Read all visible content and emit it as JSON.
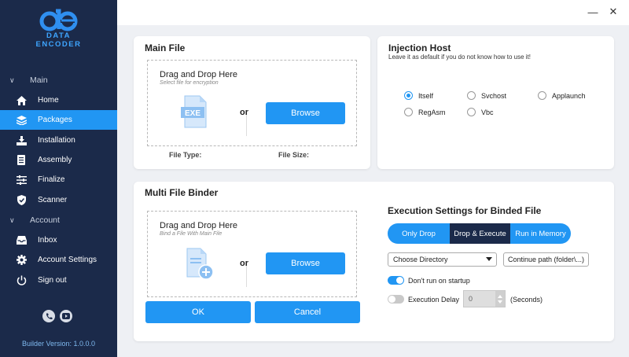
{
  "brand": {
    "line1": "DATA",
    "line2": "ENCODER"
  },
  "nav": {
    "main_label": "Main",
    "main_items": [
      {
        "label": "Home",
        "icon": "home-icon"
      },
      {
        "label": "Packages",
        "icon": "packages-icon",
        "active": true
      },
      {
        "label": "Installation",
        "icon": "installation-icon"
      },
      {
        "label": "Assembly",
        "icon": "assembly-icon"
      },
      {
        "label": "Finalize",
        "icon": "finalize-icon"
      },
      {
        "label": "Scanner",
        "icon": "shield-icon"
      }
    ],
    "account_label": "Account",
    "account_items": [
      {
        "label": "Inbox",
        "icon": "inbox-icon"
      },
      {
        "label": "Account Settings",
        "icon": "gear-icon"
      },
      {
        "label": "Sign out",
        "icon": "power-icon"
      }
    ]
  },
  "version": "Builder Version: 1.0.0.0",
  "main_file": {
    "title": "Main File",
    "drop_title": "Drag and Drop Here",
    "drop_sub": "Select file for encryption",
    "file_icon_label": "EXE",
    "or": "or",
    "browse": "Browse",
    "file_type_label": "File Type:",
    "file_size_label": "File Size:"
  },
  "injection": {
    "title": "Injection Host",
    "hint": "Leave it as default if you do not know how to use it!",
    "options": [
      "Itself",
      "Svchost",
      "Applaunch",
      "RegAsm",
      "Vbc"
    ],
    "selected": "Itself"
  },
  "binder": {
    "title": "Multi File Binder",
    "drop_title": "Drag and Drop Here",
    "drop_sub": "Bind a File With Main File",
    "or": "or",
    "browse": "Browse",
    "ok": "OK",
    "cancel": "Cancel"
  },
  "execution": {
    "title": "Execution Settings for  Binded File",
    "modes": [
      "Only Drop",
      "Drop & Execute",
      "Run in Memory"
    ],
    "selected_mode": "Drop & Execute",
    "directory_select": "Choose Directory",
    "continue_path": "Continue path (folder\\...)",
    "startup_label": "Don't run on startup",
    "startup_on": true,
    "delay_label": "Execution Delay",
    "delay_on": false,
    "delay_value": "0",
    "delay_unit": "(Seconds)"
  },
  "colors": {
    "sidebar": "#1b2a4a",
    "accent": "#2196f3"
  }
}
